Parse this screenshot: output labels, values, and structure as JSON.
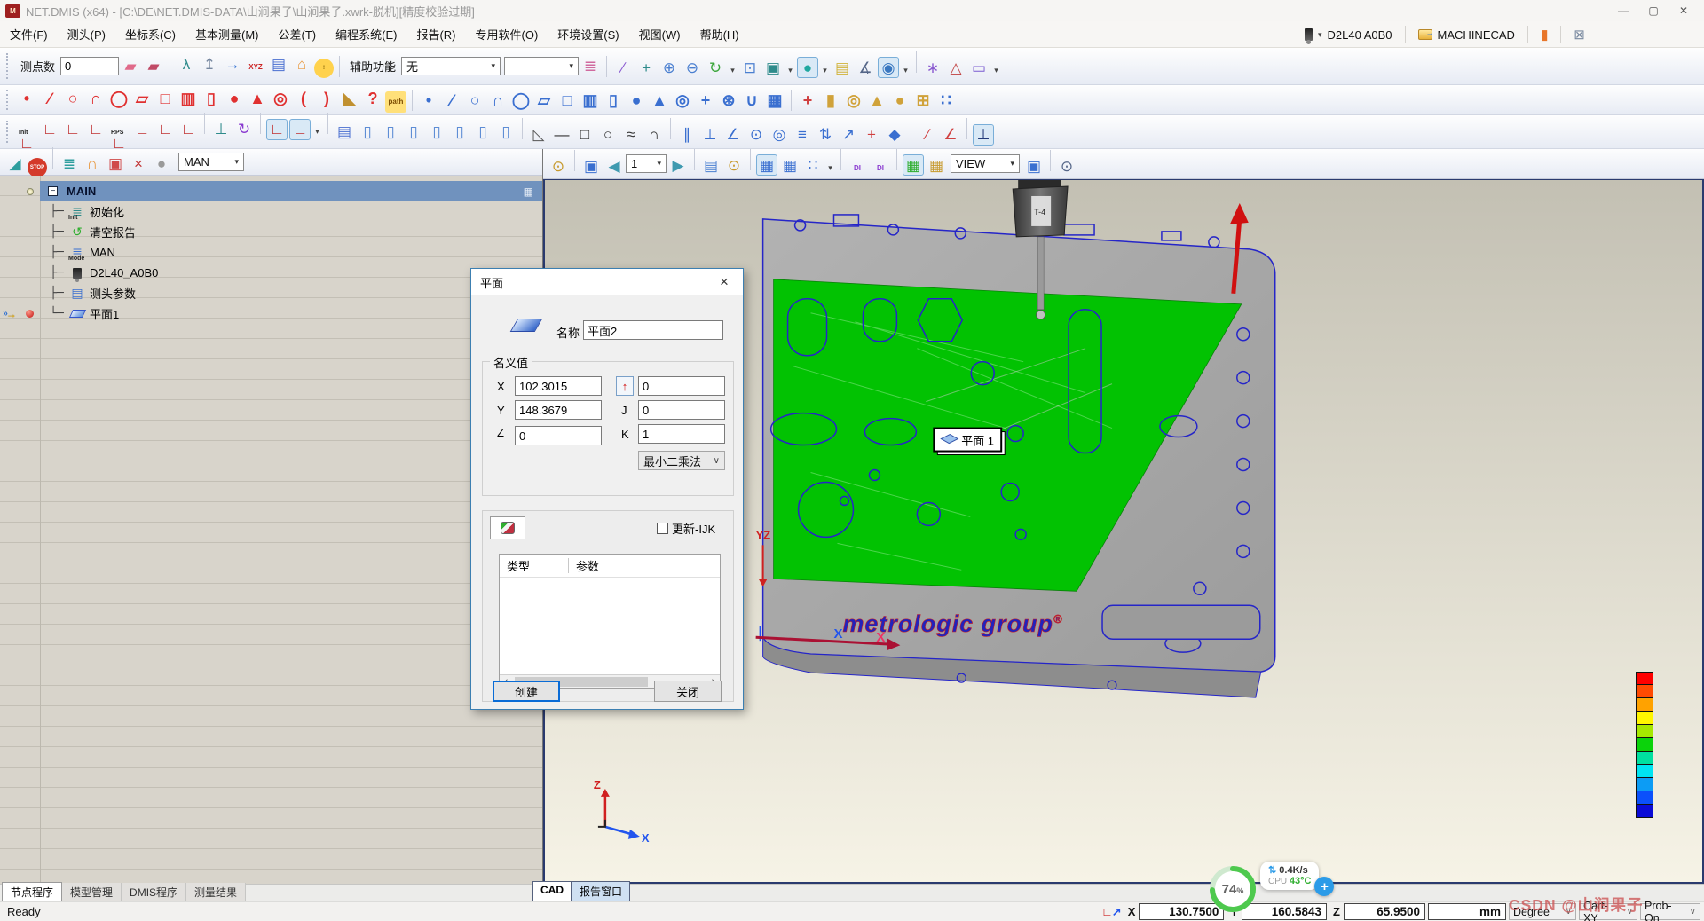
{
  "window": {
    "title": "NET.DMIS (x64) - [C:\\DE\\NET.DMIS-DATA\\山涧果子\\山涧果子.xwrk-脱机][精度校验过期]",
    "app_badge": "M",
    "minimize": "—",
    "maximize": "▢",
    "close": "✕"
  },
  "menu": {
    "items": [
      "文件(F)",
      "测头(P)",
      "坐标系(C)",
      "基本测量(M)",
      "公差(T)",
      "编程系统(E)",
      "报告(R)",
      "专用软件(O)",
      "环境设置(S)",
      "视图(W)",
      "帮助(H)"
    ],
    "probe_name": "D2L40  A0B0",
    "machine_name": "MACHINECAD",
    "chevron": "▾"
  },
  "toolbar1": {
    "points_label": "测点数",
    "points_value": "0",
    "aux_label": "辅助功能",
    "aux_value": "无",
    "aux2_value": "",
    "chevron": "▾",
    "groupA": [
      {
        "n": "clear-point-icon",
        "g": "▰",
        "c": "#e06a8a"
      },
      {
        "n": "clear-all-points-icon",
        "g": "▰",
        "c": "#c04a66"
      }
    ],
    "groupB": [
      {
        "n": "manual-measure-icon",
        "g": "λ",
        "c": "#2e8b8b"
      },
      {
        "n": "probe-position-icon",
        "g": "↥",
        "c": "#76879f"
      },
      {
        "n": "goto-position-icon",
        "g": "→",
        "c": "#2f6fd0"
      },
      {
        "n": "xyz-output-icon",
        "g": "XYZ",
        "c": "#cc2222",
        "cls": "sm"
      },
      {
        "n": "probe-report-icon",
        "g": "▤",
        "c": "#4a6fd0"
      },
      {
        "n": "home-position-icon",
        "g": "⌂",
        "c": "#e8973d"
      },
      {
        "n": "warning-icon",
        "g": "!",
        "c": "#7a5a00",
        "bg": "#ffd24d",
        "cls": "rd"
      }
    ],
    "groupC": [
      {
        "n": "layers-icon",
        "g": "≣",
        "c": "#d06a9f"
      }
    ],
    "groupD": [
      {
        "n": "highlight-brush-icon",
        "g": "∕",
        "c": "#8a5ad0"
      },
      {
        "n": "pan-view-icon",
        "g": "+",
        "c": "#2e8b8b"
      },
      {
        "n": "zoom-in-icon",
        "g": "⊕",
        "c": "#4a7fd0"
      },
      {
        "n": "zoom-out-icon",
        "g": "⊖",
        "c": "#4a7fd0"
      },
      {
        "n": "rotate-view-icon",
        "g": "↻",
        "c": "#3aa53a"
      },
      {
        "n": "rotate-options-icon",
        "g": "▾",
        "c": "#444444",
        "cls": "dd"
      },
      {
        "n": "zoom-window-icon",
        "g": "⊡",
        "c": "#4a7fd0"
      },
      {
        "n": "wire-box-icon",
        "g": "▣",
        "c": "#2e8b8b"
      },
      {
        "n": "box-options-icon",
        "g": "▾",
        "c": "#444444",
        "cls": "dd"
      },
      {
        "n": "shaded-view-icon",
        "g": "●",
        "c": "#1fa8a0",
        "cls": "bx"
      },
      {
        "n": "shade-options-icon",
        "g": "▾",
        "c": "#444444",
        "cls": "dd"
      },
      {
        "n": "annotation-note-icon",
        "g": "▤",
        "c": "#d0b23a"
      },
      {
        "n": "probe-angle-icon",
        "g": "∡",
        "c": "#556688"
      },
      {
        "n": "probe-view-icon",
        "g": "◉",
        "c": "#3a78c0",
        "cls": "bx"
      },
      {
        "n": "probe-view-options-icon",
        "g": "▾",
        "c": "#444444",
        "cls": "dd"
      },
      {
        "n": "sep"
      },
      {
        "n": "pick-star-icon",
        "g": "∗",
        "c": "#8a5ad0"
      },
      {
        "n": "measure-distance-icon",
        "g": "△",
        "c": "#c04040"
      },
      {
        "n": "monitor-icon",
        "g": "▭",
        "c": "#7a5ad0"
      },
      {
        "n": "monitor-options-icon",
        "g": "▾",
        "c": "#444444",
        "cls": "dd"
      }
    ]
  },
  "toolbar2": {
    "red": [
      {
        "n": "point-feature-icon",
        "g": "•",
        "c": "#e03030"
      },
      {
        "n": "line-feature-icon",
        "g": "∕",
        "c": "#e03030"
      },
      {
        "n": "circle-feature-icon",
        "g": "○",
        "c": "#e03030"
      },
      {
        "n": "arc-feature-icon",
        "g": "∩",
        "c": "#e03030"
      },
      {
        "n": "ellipse-feature-icon",
        "g": "◯",
        "c": "#e03030"
      },
      {
        "n": "plane-feature-icon",
        "g": "▱",
        "c": "#e03030"
      },
      {
        "n": "rect-feature-icon",
        "g": "□",
        "c": "#e03030"
      },
      {
        "n": "slot-feature-icon",
        "g": "▥",
        "c": "#e03030"
      },
      {
        "n": "cylinder-feature-icon",
        "g": "▯",
        "c": "#e03030"
      },
      {
        "n": "sphere-feature-icon",
        "g": "●",
        "c": "#e03030"
      },
      {
        "n": "cone-feature-icon",
        "g": "▲",
        "c": "#e03030"
      },
      {
        "n": "torus-feature-icon",
        "g": "◎",
        "c": "#e03030"
      },
      {
        "n": "concave-surface-icon",
        "g": "(",
        "c": "#e03030"
      },
      {
        "n": "convex-surface-icon",
        "g": ")",
        "c": "#e03030"
      },
      {
        "n": "angle-ruler-icon",
        "g": "◣",
        "c": "#c09030"
      },
      {
        "n": "unknown-feature-icon",
        "g": "?",
        "c": "#e03030"
      },
      {
        "n": "path-icon",
        "g": "path",
        "c": "#7a4a00",
        "bg": "#ffe07a",
        "cls": "sm"
      }
    ],
    "blue": [
      {
        "n": "point-construct-icon",
        "g": "•",
        "c": "#3a6fd0"
      },
      {
        "n": "line-construct-icon",
        "g": "∕",
        "c": "#3a6fd0"
      },
      {
        "n": "circle-construct-icon",
        "g": "○",
        "c": "#3a6fd0"
      },
      {
        "n": "arc-construct-icon",
        "g": "∩",
        "c": "#3a6fd0"
      },
      {
        "n": "ellipse-construct-icon",
        "g": "◯",
        "c": "#3a6fd0"
      },
      {
        "n": "plane-construct-icon",
        "g": "▱",
        "c": "#3a6fd0"
      },
      {
        "n": "rect-construct-icon",
        "g": "□",
        "c": "#3a6fd0"
      },
      {
        "n": "slot-construct-icon",
        "g": "▥",
        "c": "#3a6fd0"
      },
      {
        "n": "cylinder-construct-icon",
        "g": "▯",
        "c": "#3a6fd0"
      },
      {
        "n": "sphere-construct-icon",
        "g": "●",
        "c": "#3a6fd0"
      },
      {
        "n": "cone-construct-icon",
        "g": "▲",
        "c": "#3a6fd0"
      },
      {
        "n": "torus-construct-icon",
        "g": "◎",
        "c": "#3a6fd0"
      },
      {
        "n": "cross3d-construct-icon",
        "g": "+",
        "c": "#3a6fd0"
      },
      {
        "n": "gear-icon",
        "g": "⊛",
        "c": "#3a6fd0"
      },
      {
        "n": "u-profile-icon",
        "g": "∪",
        "c": "#3a6fd0"
      },
      {
        "n": "mesh-icon",
        "g": "▦",
        "c": "#3a6fd0"
      }
    ],
    "gold": [
      {
        "n": "colored-cross-icon",
        "g": "+",
        "c": "#d04040"
      },
      {
        "n": "gold-cylinder-icon",
        "g": "▮",
        "c": "#d0a23a"
      },
      {
        "n": "gold-ring-icon",
        "g": "◎",
        "c": "#d0a23a"
      },
      {
        "n": "gold-cone-icon",
        "g": "▲",
        "c": "#d0a23a"
      },
      {
        "n": "gold-sphere-icon",
        "g": "●",
        "c": "#d0a23a"
      },
      {
        "n": "grid-icon",
        "g": "⊞",
        "c": "#d0a23a"
      },
      {
        "n": "matrix-dots-icon",
        "g": "∷",
        "c": "#3a6fd0"
      }
    ]
  },
  "toolbar3": {
    "coord": [
      {
        "n": "cs-init-icon",
        "g": "∟",
        "c": "#c03030",
        "lbl": "Init"
      },
      {
        "n": "cs-recall-icon",
        "g": "∟",
        "c": "#c03030"
      },
      {
        "n": "cs-cube-icon",
        "g": "∟",
        "c": "#c03030"
      },
      {
        "n": "cs-3point-icon",
        "g": "∟",
        "c": "#c03030"
      },
      {
        "n": "cs-rps-icon",
        "g": "∟",
        "c": "#c03030",
        "lbl": "RPS"
      },
      {
        "n": "cs-6point-icon",
        "g": "∟",
        "c": "#c03030"
      },
      {
        "n": "cs-cylinder-icon",
        "g": "∟",
        "c": "#c03030"
      },
      {
        "n": "cs-freeform-icon",
        "g": "∟",
        "c": "#c03030"
      },
      {
        "n": "sep"
      },
      {
        "n": "machine-cs-icon",
        "g": "⊥",
        "c": "#2e8b8b"
      },
      {
        "n": "rotate-cs-icon",
        "g": "↻",
        "c": "#8a3ad0"
      },
      {
        "n": "sep"
      },
      {
        "n": "work-cs-icon",
        "g": "∟",
        "c": "#c03030",
        "cls": "bx"
      },
      {
        "n": "ref-cs-icon",
        "g": "∟",
        "c": "#c03030",
        "cls": "bx"
      },
      {
        "n": "cs-more-icon",
        "g": "▾",
        "c": "#444444",
        "cls": "dd"
      },
      {
        "n": "sep"
      }
    ],
    "cyl": [
      {
        "n": "surface-report-icon",
        "g": "▤",
        "c": "#4a6fd0"
      },
      {
        "n": "cyl-top-icon",
        "g": "▯",
        "c": "#4a7fd0"
      },
      {
        "n": "cyl-concave-icon",
        "g": "▯",
        "c": "#4a7fd0"
      },
      {
        "n": "cyl-convex-icon",
        "g": "▯",
        "c": "#4a7fd0"
      },
      {
        "n": "cyl-slant-icon",
        "g": "▯",
        "c": "#4a7fd0"
      },
      {
        "n": "cyl-ring-icon",
        "g": "▯",
        "c": "#4a7fd0"
      },
      {
        "n": "cyl-section-icon",
        "g": "▯",
        "c": "#4a7fd0"
      },
      {
        "n": "cyl-curve-icon",
        "g": "▯",
        "c": "#4a7fd0"
      }
    ],
    "outline": [
      {
        "n": "sep"
      },
      {
        "n": "level-icon",
        "g": "◺",
        "c": "#555555"
      },
      {
        "n": "line2d-icon",
        "g": "—",
        "c": "#333333"
      },
      {
        "n": "rect2d-icon",
        "g": "□",
        "c": "#333333"
      },
      {
        "n": "circle2d-icon",
        "g": "○",
        "c": "#333333"
      },
      {
        "n": "curve2d-icon",
        "g": "≈",
        "c": "#333333"
      },
      {
        "n": "arc2d-icon",
        "g": "∩",
        "c": "#333333"
      },
      {
        "n": "sep"
      }
    ],
    "relation": [
      {
        "n": "parallel-icon",
        "g": "∥",
        "c": "#3a6fd0"
      },
      {
        "n": "perpendicular-icon",
        "g": "⊥",
        "c": "#3a6fd0"
      },
      {
        "n": "angle-relation-icon",
        "g": "∠",
        "c": "#3a6fd0"
      },
      {
        "n": "concentric-icon",
        "g": "⊙",
        "c": "#3a6fd0"
      },
      {
        "n": "runout-icon",
        "g": "◎",
        "c": "#3a6fd0"
      },
      {
        "n": "symmetry-icon",
        "g": "≡",
        "c": "#3a6fd0"
      },
      {
        "n": "updown-icon",
        "g": "⇅",
        "c": "#3a6fd0"
      },
      {
        "n": "vector-icon",
        "g": "↗",
        "c": "#3a6fd0"
      },
      {
        "n": "position-icon",
        "g": "+",
        "c": "#d04040"
      },
      {
        "n": "diamond-icon",
        "g": "◆",
        "c": "#3a6fd0"
      },
      {
        "n": "sep"
      },
      {
        "n": "edit-feature-icon",
        "g": "∕",
        "c": "#d04040"
      },
      {
        "n": "angle-measure-red-icon",
        "g": "∠",
        "c": "#d04040"
      },
      {
        "n": "sep"
      },
      {
        "n": "datum-icon",
        "g": "⊥",
        "c": "#223a7a",
        "cls": "bx"
      }
    ]
  },
  "left_panel": {
    "toolbar": [
      {
        "n": "speed-curve-icon",
        "g": "◢",
        "c": "#2e9e9e"
      },
      {
        "n": "stop-icon",
        "g": "STOP",
        "c": "#ffffff",
        "bg": "#d43a2a",
        "cls": "rd"
      },
      {
        "n": "sep"
      },
      {
        "n": "run-program-icon",
        "g": "≣",
        "c": "#2e9e9e"
      },
      {
        "n": "unlock-icon",
        "g": "∩",
        "c": "#e8973d"
      },
      {
        "n": "window-output-icon",
        "g": "▣",
        "c": "#d04a4a"
      },
      {
        "n": "delete-feature-icon",
        "g": "×",
        "c": "#c03030"
      },
      {
        "n": "ball-insert-icon",
        "g": "●",
        "c": "#9a9a9a"
      }
    ],
    "mode_value": "MAN",
    "chevron": "▾",
    "tree": [
      {
        "label": "MAIN",
        "icon": "main",
        "selected": true,
        "expander": "−",
        "bulb": true
      },
      {
        "label": "初始化",
        "icon": "init",
        "sub": "Init"
      },
      {
        "label": "清空报告",
        "icon": "recycle"
      },
      {
        "label": "MAN",
        "icon": "mode",
        "sub": "Mode"
      },
      {
        "label": "D2L40_A0B0",
        "icon": "probe"
      },
      {
        "label": "测头参数",
        "icon": "probedoc"
      },
      {
        "label": "平面1",
        "icon": "plane",
        "marker": true,
        "last": true
      }
    ]
  },
  "cad_toolbar": {
    "groupA": [
      {
        "n": "run-alarm-icon",
        "g": "⊙",
        "c": "#c79a2e"
      },
      {
        "n": "sep"
      },
      {
        "n": "save-report-icon",
        "g": "▣",
        "c": "#3a6fd0"
      },
      {
        "n": "prev-page-icon",
        "g": "◀",
        "c": "#3f9ab0"
      }
    ],
    "page_value": "1",
    "chevron": "▾",
    "groupB": [
      {
        "n": "next-page-icon",
        "g": "▶",
        "c": "#3f9ab0"
      },
      {
        "n": "sep"
      },
      {
        "n": "new-report-icon",
        "g": "▤",
        "c": "#4a7fd0"
      },
      {
        "n": "report-run-icon",
        "g": "⊙",
        "c": "#c79a2e"
      },
      {
        "n": "sep"
      },
      {
        "n": "report-table-icon",
        "g": "▦",
        "c": "#3a6fd0",
        "cls": "bx"
      },
      {
        "n": "table-pick-icon",
        "g": "▦",
        "c": "#3a6fd0"
      },
      {
        "n": "cell-grid-icon",
        "g": "∷",
        "c": "#3a6fd0"
      },
      {
        "n": "grid-options-icon",
        "g": "▾",
        "c": "#444444",
        "cls": "dd"
      },
      {
        "n": "sep"
      },
      {
        "n": "dmis-edit-icon",
        "g": "DI",
        "c": "#8a3ad0",
        "cls": "sm"
      },
      {
        "n": "dmis-pick-icon",
        "g": "DI",
        "c": "#8a3ad0",
        "cls": "sm"
      },
      {
        "n": "sep"
      },
      {
        "n": "live-table-icon",
        "g": "▦",
        "c": "#2fae2f",
        "cls": "bx"
      },
      {
        "n": "table-timer-icon",
        "g": "▦",
        "c": "#c79a2e"
      }
    ],
    "view_value": "VIEW",
    "groupC": [
      {
        "n": "save-view-icon",
        "g": "▣",
        "c": "#3a6fd0"
      },
      {
        "n": "sep"
      },
      {
        "n": "preview-icon",
        "g": "⊙",
        "c": "#556688"
      }
    ]
  },
  "viewport": {
    "plane_tag": "平面 1",
    "brand": "metrologic group",
    "brand_reg": "®",
    "probe_label": "T-4",
    "axis_yz": "YZ",
    "axis_x_blue": "X",
    "axis_x_pink": "X",
    "axis_z": "Z",
    "axis_x2": "X",
    "color_scale": [
      "#fe0000",
      "#ff4a02",
      "#ffa200",
      "#fff600",
      "#a6e800",
      "#0bd30b",
      "#00e0a0",
      "#00e4f2",
      "#0c9cf5",
      "#0b50fb",
      "#0b0bd6"
    ]
  },
  "dialog": {
    "title": "平面",
    "close": "×",
    "name_label": "名称",
    "name_value": "平面2",
    "nominal_label": "名义值",
    "x_label": "X",
    "x_value": "102.3015",
    "y_label": "Y",
    "y_value": "148.3679",
    "z_label": "Z",
    "z_value": "0",
    "i_arrow": "↑",
    "i_value": "0",
    "j_label": "J",
    "j_value": "0",
    "k_label": "K",
    "k_value": "1",
    "method_value": "最小二乘法",
    "method_chevron": "∨",
    "update_label": "更新-IJK",
    "col_type": "类型",
    "col_param": "参数",
    "scroll_left": "‹",
    "scroll_right": "›",
    "create_label": "创建",
    "close_label": "关闭"
  },
  "perf": {
    "percent": "74",
    "percent_sign": "%",
    "rate_icon": "⇅",
    "rate": "0.4K/s",
    "cpu_label": "CPU",
    "cpu_temp": "43°C",
    "plus": "+"
  },
  "bottom": {
    "left_tabs": [
      {
        "label": "节点程序",
        "active": true
      },
      {
        "label": "模型管理"
      },
      {
        "label": "DMIS程序"
      },
      {
        "label": "测量结果"
      }
    ],
    "view_tabs": [
      {
        "label": "CAD",
        "active": true
      },
      {
        "label": "报告窗口"
      }
    ],
    "status": "Ready",
    "coords": {
      "axis_glyph1": "∟",
      "axis_glyph2": "↗",
      "x_label": "X",
      "x_value": "130.7500",
      "y_label": "Y",
      "y_value": "160.5843",
      "z_label": "Z",
      "z_value": "65.9500",
      "units": "mm",
      "angle_mode": "Degree",
      "coord_mode": "Cart-XY",
      "probe_mode": "Prob-On",
      "chevron": "∨"
    }
  },
  "watermark": "CSDN @山涧果子"
}
